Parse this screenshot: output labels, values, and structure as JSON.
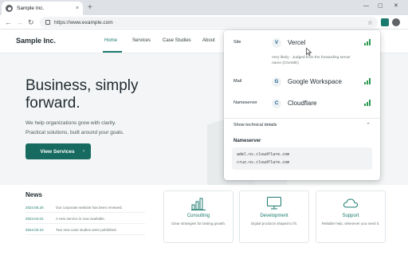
{
  "browser": {
    "tab_title": "Sample Inc.",
    "tab_close": "×",
    "new_tab": "+",
    "win_min": "—",
    "win_max": "▢",
    "win_close": "✕",
    "back": "←",
    "forward": "→",
    "reload": "↻",
    "url": "https://www.example.com",
    "star": "☆"
  },
  "site": {
    "brand": "Sample Inc.",
    "nav": [
      "Home",
      "Services",
      "Case Studies",
      "About"
    ],
    "hero": {
      "title_line1": "Business, simply",
      "title_line2": "forward.",
      "lead_line1": "We help organizations grow with clarity.",
      "lead_line2": "Practical solutions, built around your goals.",
      "cta": "View Services",
      "cta_arrow": "›"
    },
    "news": {
      "heading": "News",
      "items": [
        {
          "date": "2024.05.20",
          "text": "Our corporate website has been renewed."
        },
        {
          "date": "2024.04.01",
          "text": "A new service is now available."
        },
        {
          "date": "2024.03.10",
          "text": "Two new case studies were published."
        }
      ]
    },
    "cards": [
      {
        "title": "Consulting",
        "desc": "Clear strategies for lasting growth.",
        "icon": "bar-chart-icon"
      },
      {
        "title": "Development",
        "desc": "Digital products shaped to fit.",
        "icon": "monitor-icon"
      },
      {
        "title": "Support",
        "desc": "Reliable help, whenever you need it.",
        "icon": "cloud-icon"
      }
    ]
  },
  "popup": {
    "rows": [
      {
        "label": "Site",
        "logo": "V",
        "name": "Vercel"
      },
      {
        "label": "Mail",
        "logo": "G",
        "name": "Google Workspace"
      },
      {
        "label": "Nameserver",
        "logo": "C",
        "name": "Cloudflare"
      }
    ],
    "note": "Very likely · Judged from the forwarding server name (CNAME)",
    "toggle": "Show technical details",
    "chevron": "⌃",
    "ns_heading": "Nameserver",
    "ns_values": [
      "adel.ns.cloudflare.com",
      "cruz.ns.cloudflare.com"
    ],
    "signal_color": "#2e9a55"
  },
  "colors": {
    "accent": "#1b7a6e",
    "cta": "#176a60"
  }
}
